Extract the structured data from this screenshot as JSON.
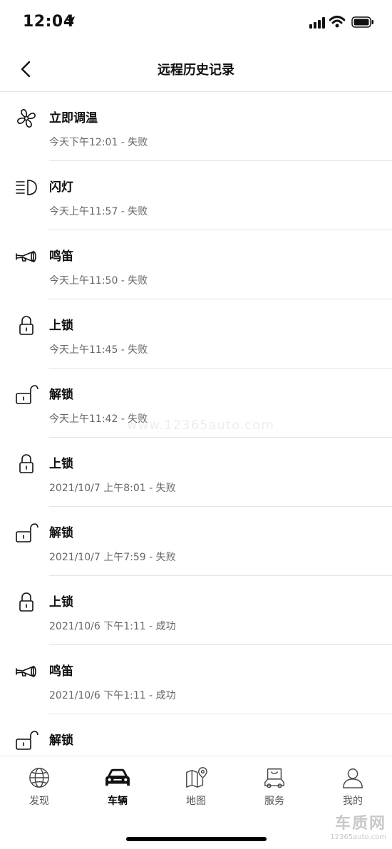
{
  "status_bar": {
    "time": "12:04"
  },
  "nav": {
    "title": "远程历史记录"
  },
  "history": [
    {
      "icon": "fan-icon",
      "name": "立即调温",
      "meta": "今天下午12:01 - 失败"
    },
    {
      "icon": "headlight-icon",
      "name": "闪灯",
      "meta": "今天上午11:57 - 失败"
    },
    {
      "icon": "horn-icon",
      "name": "鸣笛",
      "meta": "今天上午11:50 - 失败"
    },
    {
      "icon": "lock-icon",
      "name": "上锁",
      "meta": "今天上午11:45 - 失败"
    },
    {
      "icon": "unlock-icon",
      "name": "解锁",
      "meta": "今天上午11:42 - 失败"
    },
    {
      "icon": "lock-icon",
      "name": "上锁",
      "meta": "2021/10/7 上午8:01 - 失败"
    },
    {
      "icon": "unlock-icon",
      "name": "解锁",
      "meta": "2021/10/7 上午7:59 - 失败"
    },
    {
      "icon": "lock-icon",
      "name": "上锁",
      "meta": "2021/10/6 下午1:11 - 成功"
    },
    {
      "icon": "horn-icon",
      "name": "鸣笛",
      "meta": "2021/10/6 下午1:11 - 成功"
    },
    {
      "icon": "unlock-icon",
      "name": "解锁",
      "meta": ""
    }
  ],
  "watermark": "www.12365auto.com",
  "tabs": [
    {
      "icon": "globe-icon",
      "label": "发现",
      "active": false
    },
    {
      "icon": "car-icon",
      "label": "车辆",
      "active": true
    },
    {
      "icon": "map-icon",
      "label": "地图",
      "active": false
    },
    {
      "icon": "service-bag-icon",
      "label": "服务",
      "active": false
    },
    {
      "icon": "person-icon",
      "label": "我的",
      "active": false
    }
  ],
  "corner_logo": {
    "big": "车质网",
    "small": "12365auto.com"
  }
}
